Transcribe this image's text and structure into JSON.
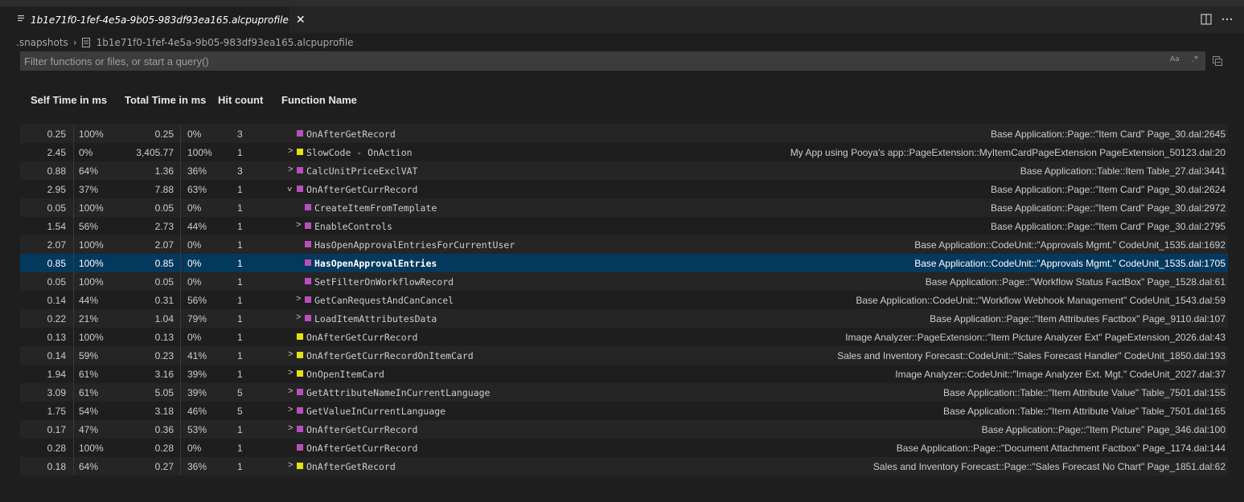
{
  "tab": {
    "title": "1b1e71f0-1fef-4e5a-9b05-983df93ea165.alcpuprofile",
    "close_glyph": "✕"
  },
  "breadcrumb": {
    "folder": ".snapshots",
    "separator": "›",
    "file": "1b1e71f0-1fef-4e5a-9b05-983df93ea165.alcpuprofile"
  },
  "filter": {
    "placeholder": "Filter functions or files, or start a query()",
    "value": "",
    "match_case_label": "Aa",
    "regex_label": ".*"
  },
  "columns": {
    "self_time": "Self Time in ms",
    "total_time": "Total Time in ms",
    "hit_count": "Hit count",
    "function_name": "Function Name"
  },
  "colors": {
    "app_magenta": "#b94fbf",
    "app_yellow": "#e3e30f",
    "selected_row": "#04395e"
  },
  "rows": [
    {
      "self_ms": "0.25",
      "self_pct": "100%",
      "total_ms": "0.25",
      "total_pct": "0%",
      "hits": "3",
      "depth": 0,
      "expander": "",
      "color": "magenta",
      "fn": "OnAfterGetRecord",
      "src": "Base Application::Page::\"Item Card\" Page_30.dal:2645"
    },
    {
      "self_ms": "2.45",
      "self_pct": "0%",
      "total_ms": "3,405.77",
      "total_pct": "100%",
      "hits": "1",
      "depth": 0,
      "expander": ">",
      "color": "yellow",
      "fn": "SlowCode - OnAction",
      "src": "My App using Pooya's app::PageExtension::MyItemCardPageExtension PageExtension_50123.dal:20"
    },
    {
      "self_ms": "0.88",
      "self_pct": "64%",
      "total_ms": "1.36",
      "total_pct": "36%",
      "hits": "3",
      "depth": 0,
      "expander": ">",
      "color": "magenta",
      "fn": "CalcUnitPriceExclVAT",
      "src": "Base Application::Table::Item Table_27.dal:3441"
    },
    {
      "self_ms": "2.95",
      "self_pct": "37%",
      "total_ms": "7.88",
      "total_pct": "63%",
      "hits": "1",
      "depth": 0,
      "expander": "v",
      "color": "magenta",
      "fn": "OnAfterGetCurrRecord",
      "src": "Base Application::Page::\"Item Card\" Page_30.dal:2624"
    },
    {
      "self_ms": "0.05",
      "self_pct": "100%",
      "total_ms": "0.05",
      "total_pct": "0%",
      "hits": "1",
      "depth": 1,
      "expander": "",
      "color": "magenta",
      "fn": "CreateItemFromTemplate",
      "src": "Base Application::Page::\"Item Card\" Page_30.dal:2972"
    },
    {
      "self_ms": "1.54",
      "self_pct": "56%",
      "total_ms": "2.73",
      "total_pct": "44%",
      "hits": "1",
      "depth": 1,
      "expander": ">",
      "color": "magenta",
      "fn": "EnableControls",
      "src": "Base Application::Page::\"Item Card\" Page_30.dal:2795"
    },
    {
      "self_ms": "2.07",
      "self_pct": "100%",
      "total_ms": "2.07",
      "total_pct": "0%",
      "hits": "1",
      "depth": 1,
      "expander": "",
      "color": "magenta",
      "fn": "HasOpenApprovalEntriesForCurrentUser",
      "src": "Base Application::CodeUnit::\"Approvals Mgmt.\" CodeUnit_1535.dal:1692"
    },
    {
      "self_ms": "0.85",
      "self_pct": "100%",
      "total_ms": "0.85",
      "total_pct": "0%",
      "hits": "1",
      "depth": 1,
      "expander": "",
      "color": "magenta",
      "fn": "HasOpenApprovalEntries",
      "src": "Base Application::CodeUnit::\"Approvals Mgmt.\" CodeUnit_1535.dal:1705",
      "selected": true
    },
    {
      "self_ms": "0.05",
      "self_pct": "100%",
      "total_ms": "0.05",
      "total_pct": "0%",
      "hits": "1",
      "depth": 1,
      "expander": "",
      "color": "magenta",
      "fn": "SetFilterOnWorkflowRecord",
      "src": "Base Application::Page::\"Workflow Status FactBox\" Page_1528.dal:61"
    },
    {
      "self_ms": "0.14",
      "self_pct": "44%",
      "total_ms": "0.31",
      "total_pct": "56%",
      "hits": "1",
      "depth": 1,
      "expander": ">",
      "color": "magenta",
      "fn": "GetCanRequestAndCanCancel",
      "src": "Base Application::CodeUnit::\"Workflow Webhook Management\" CodeUnit_1543.dal:59"
    },
    {
      "self_ms": "0.22",
      "self_pct": "21%",
      "total_ms": "1.04",
      "total_pct": "79%",
      "hits": "1",
      "depth": 1,
      "expander": ">",
      "color": "magenta",
      "fn": "LoadItemAttributesData",
      "src": "Base Application::Page::\"Item Attributes Factbox\" Page_9110.dal:107"
    },
    {
      "self_ms": "0.13",
      "self_pct": "100%",
      "total_ms": "0.13",
      "total_pct": "0%",
      "hits": "1",
      "depth": 0,
      "expander": "",
      "color": "yellow",
      "fn": "OnAfterGetCurrRecord",
      "src": "Image Analyzer::PageExtension::\"Item Picture Analyzer Ext\" PageExtension_2026.dal:43"
    },
    {
      "self_ms": "0.14",
      "self_pct": "59%",
      "total_ms": "0.23",
      "total_pct": "41%",
      "hits": "1",
      "depth": 0,
      "expander": ">",
      "color": "yellow",
      "fn": "OnAfterGetCurrRecordOnItemCard",
      "src": "Sales and Inventory Forecast::CodeUnit::\"Sales Forecast Handler\" CodeUnit_1850.dal:193"
    },
    {
      "self_ms": "1.94",
      "self_pct": "61%",
      "total_ms": "3.16",
      "total_pct": "39%",
      "hits": "1",
      "depth": 0,
      "expander": ">",
      "color": "yellow",
      "fn": "OnOpenItemCard",
      "src": "Image Analyzer::CodeUnit::\"Image Analyzer Ext. Mgt.\" CodeUnit_2027.dal:37"
    },
    {
      "self_ms": "3.09",
      "self_pct": "61%",
      "total_ms": "5.05",
      "total_pct": "39%",
      "hits": "5",
      "depth": 0,
      "expander": ">",
      "color": "magenta",
      "fn": "GetAttributeNameInCurrentLanguage",
      "src": "Base Application::Table::\"Item Attribute Value\" Table_7501.dal:155"
    },
    {
      "self_ms": "1.75",
      "self_pct": "54%",
      "total_ms": "3.18",
      "total_pct": "46%",
      "hits": "5",
      "depth": 0,
      "expander": ">",
      "color": "magenta",
      "fn": "GetValueInCurrentLanguage",
      "src": "Base Application::Table::\"Item Attribute Value\" Table_7501.dal:165"
    },
    {
      "self_ms": "0.17",
      "self_pct": "47%",
      "total_ms": "0.36",
      "total_pct": "53%",
      "hits": "1",
      "depth": 0,
      "expander": ">",
      "color": "magenta",
      "fn": "OnAfterGetCurrRecord",
      "src": "Base Application::Page::\"Item Picture\" Page_346.dal:100"
    },
    {
      "self_ms": "0.28",
      "self_pct": "100%",
      "total_ms": "0.28",
      "total_pct": "0%",
      "hits": "1",
      "depth": 0,
      "expander": "",
      "color": "magenta",
      "fn": "OnAfterGetCurrRecord",
      "src": "Base Application::Page::\"Document Attachment Factbox\" Page_1174.dal:144"
    },
    {
      "self_ms": "0.18",
      "self_pct": "64%",
      "total_ms": "0.27",
      "total_pct": "36%",
      "hits": "1",
      "depth": 0,
      "expander": ">",
      "color": "yellow",
      "fn": "OnAfterGetRecord",
      "src": "Sales and Inventory Forecast::Page::\"Sales Forecast No Chart\" Page_1851.dal:62"
    }
  ]
}
